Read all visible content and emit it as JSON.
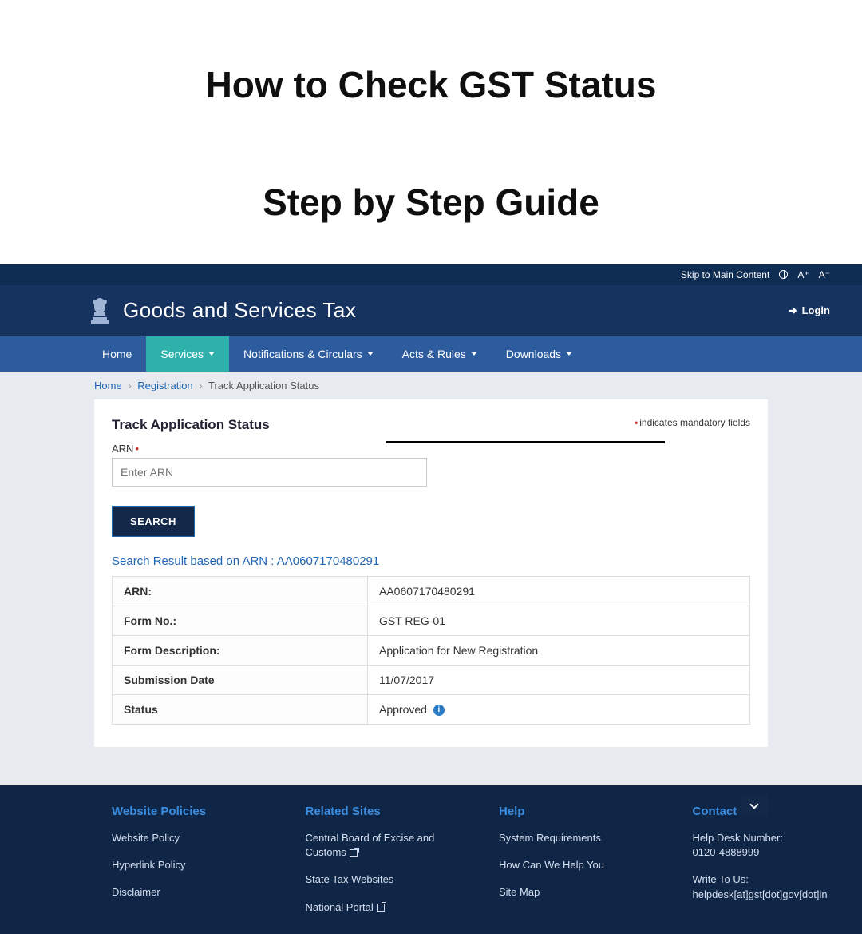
{
  "overlay_title_line1": "How to Check GST Status",
  "overlay_title_line2": "Step by Step Guide",
  "utility": {
    "skip_text": "Skip to Main Content",
    "a_plus": "A⁺",
    "a_minus": "A⁻"
  },
  "header": {
    "brand_title": "Goods and Services Tax",
    "login_label": "Login"
  },
  "nav": {
    "items": [
      {
        "label": "Home",
        "has_caret": false,
        "active": false
      },
      {
        "label": "Services",
        "has_caret": true,
        "active": true
      },
      {
        "label": "Notifications & Circulars",
        "has_caret": true,
        "active": false
      },
      {
        "label": "Acts & Rules",
        "has_caret": true,
        "active": false
      },
      {
        "label": "Downloads",
        "has_caret": true,
        "active": false
      }
    ]
  },
  "breadcrumb": {
    "home": "Home",
    "registration": "Registration",
    "current": "Track Application Status"
  },
  "panel": {
    "title": "Track Application Status",
    "mandatory_note": "indicates mandatory fields",
    "arn_label": "ARN",
    "arn_placeholder": "Enter ARN",
    "search_button": "SEARCH",
    "result_heading": "Search Result based on ARN : AA0607170480291",
    "rows": [
      {
        "label": "ARN:",
        "value": "AA0607170480291"
      },
      {
        "label": "Form No.:",
        "value": "GST REG-01"
      },
      {
        "label": "Form Description:",
        "value": "Application for New Registration"
      },
      {
        "label": "Submission Date",
        "value": "11/07/2017"
      },
      {
        "label": "Status",
        "value": "Approved"
      }
    ]
  },
  "footer": {
    "cols": [
      {
        "heading": "Website Policies",
        "links": [
          "Website Policy",
          "Hyperlink Policy",
          "Disclaimer"
        ]
      },
      {
        "heading": "Related Sites",
        "links": [
          "Central Board of Excise and Customs",
          "State Tax Websites",
          "National Portal"
        ]
      },
      {
        "heading": "Help",
        "links": [
          "System Requirements",
          "How Can We Help You",
          "Site Map"
        ]
      },
      {
        "heading": "Contact Us",
        "links": [
          "Help Desk Number:\n0120-4888999",
          "Write To Us:\nhelpdesk[at]gst[dot]gov[dot]in"
        ]
      }
    ]
  }
}
